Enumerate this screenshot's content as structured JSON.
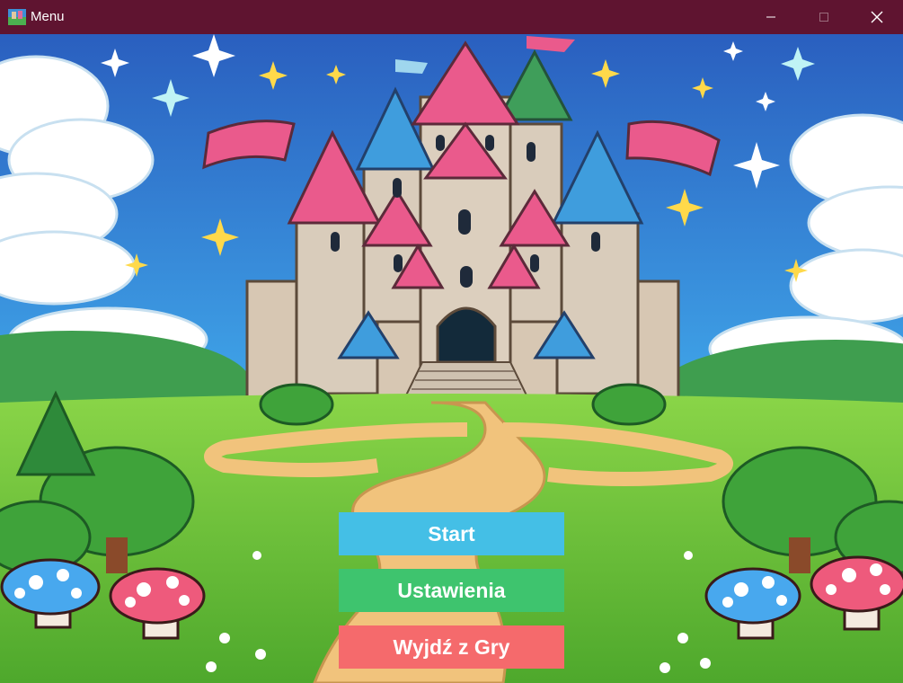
{
  "window": {
    "title": "Menu",
    "app_icon": "landscape-app-icon",
    "controls": [
      "minimize-icon",
      "maximize-icon",
      "close-icon"
    ],
    "titlebar_color": "#5f1430"
  },
  "menu": {
    "start_label": "Start",
    "settings_label": "Ustawienia",
    "exit_label": "Wyjdź z Gry",
    "start_color": "#44bfe6",
    "settings_color": "#3ec46e",
    "exit_color": "#f56a6c"
  }
}
